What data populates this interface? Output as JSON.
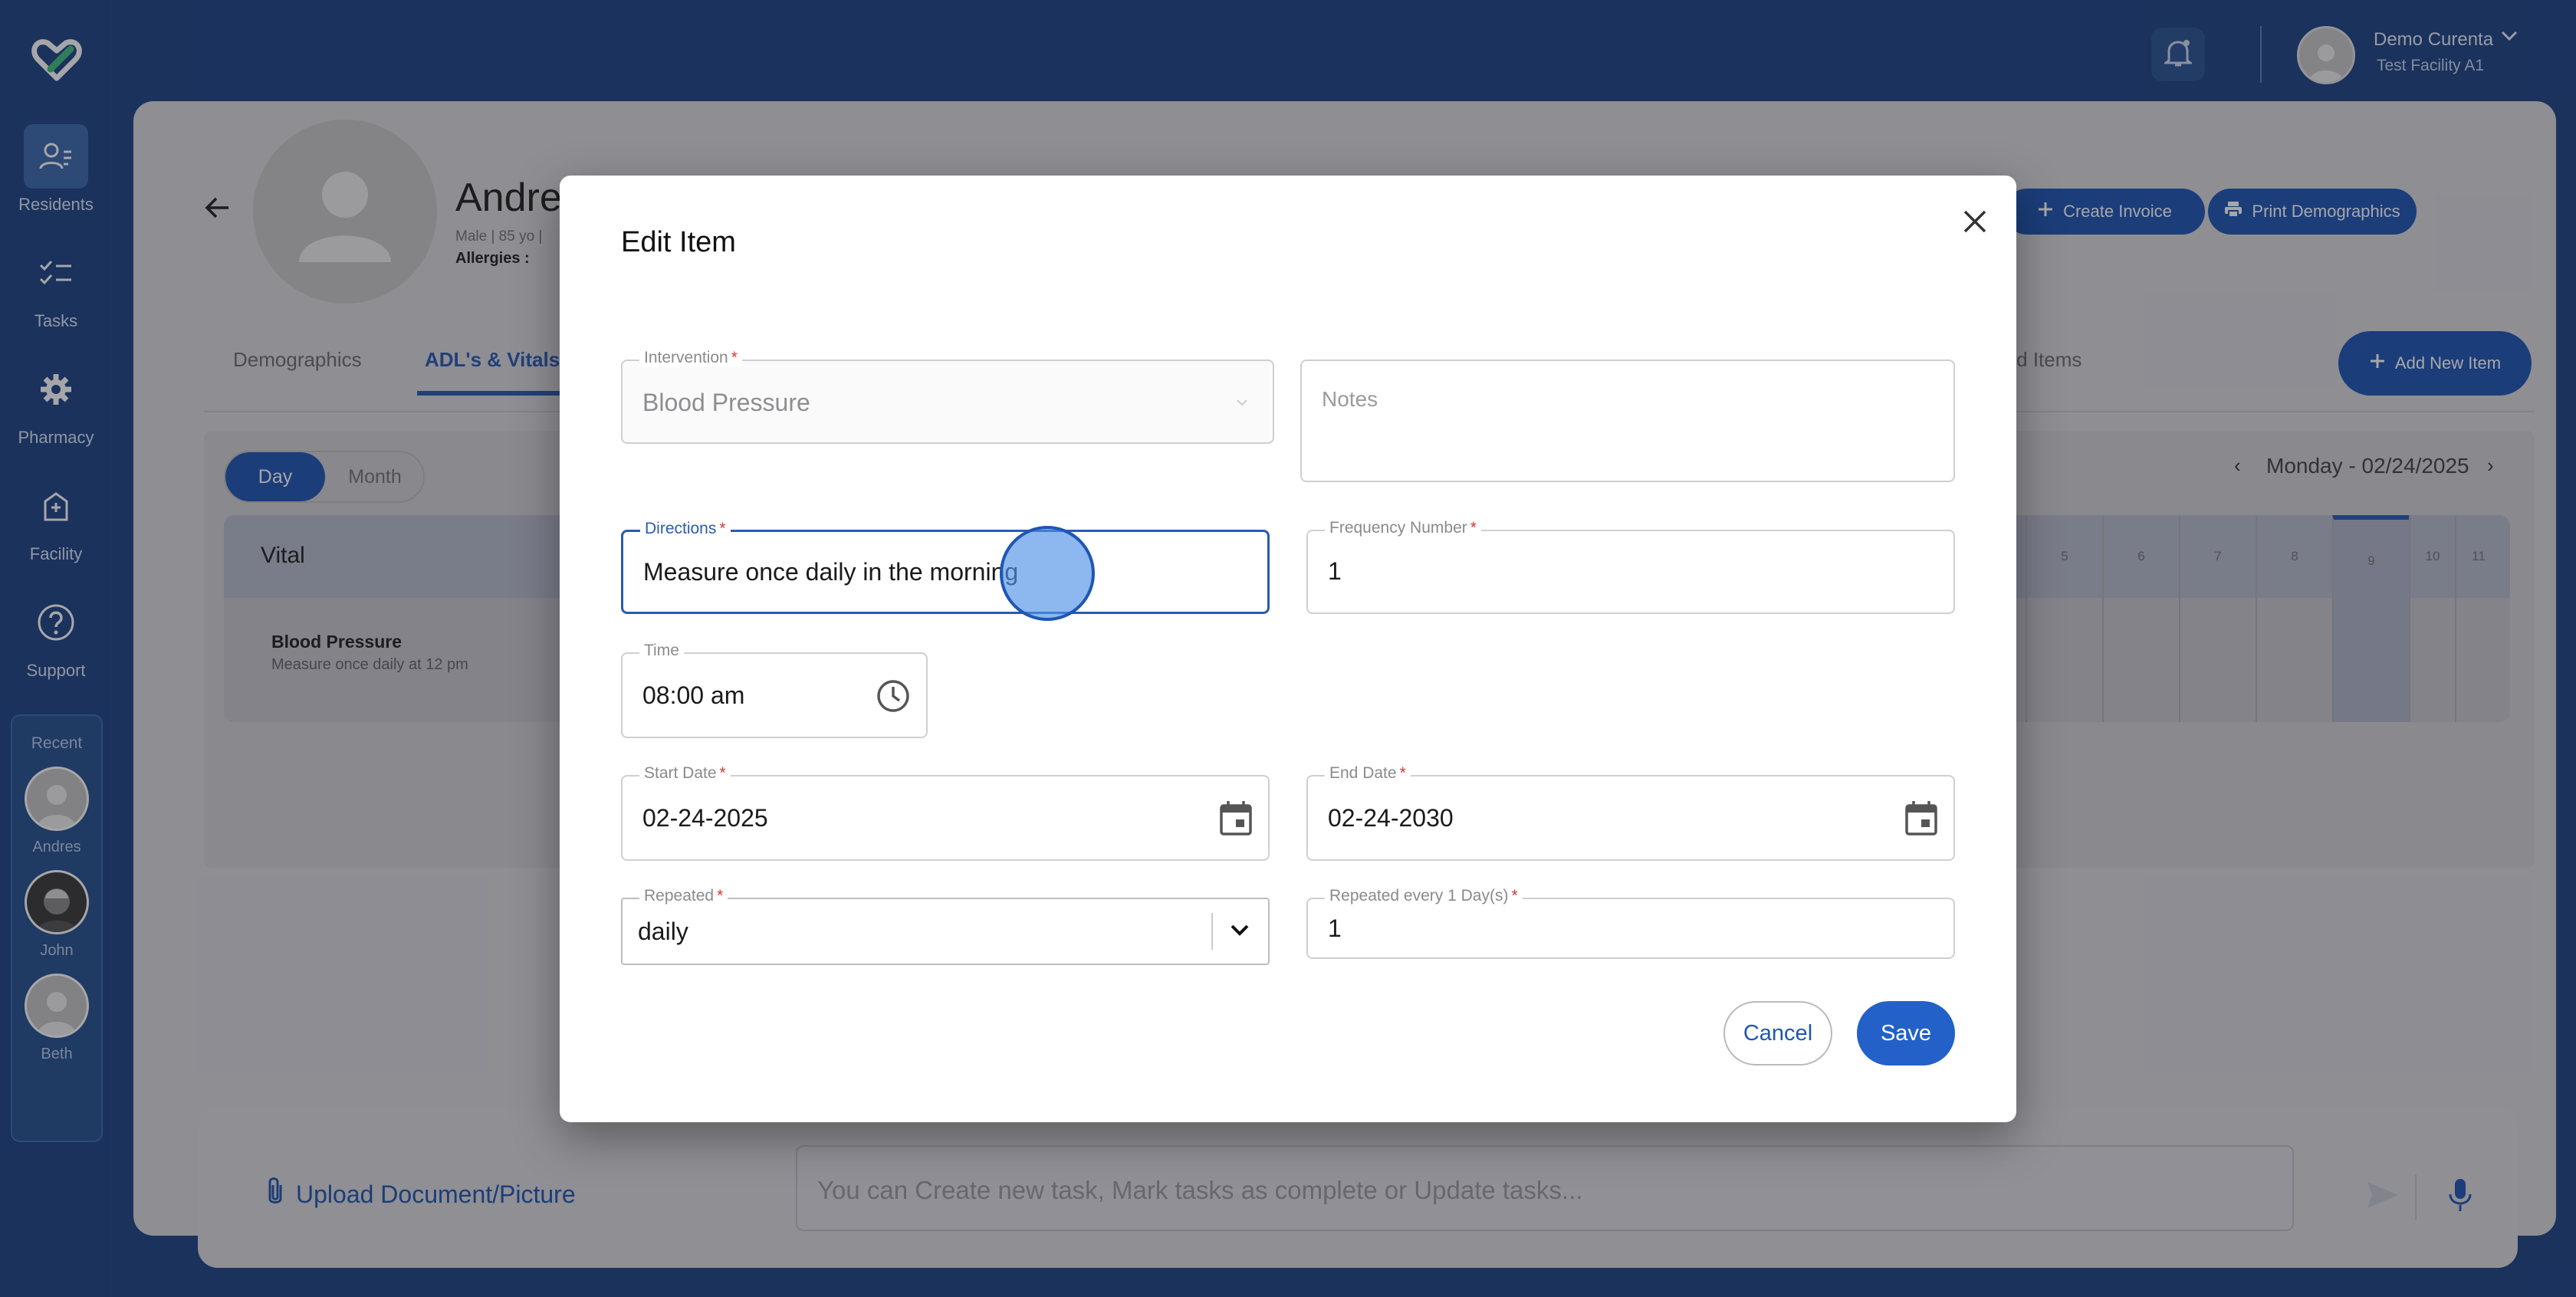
{
  "sidebar": {
    "items": [
      {
        "label": "Residents",
        "icon": "residents-icon"
      },
      {
        "label": "Tasks",
        "icon": "tasks-icon"
      },
      {
        "label": "Pharmacy",
        "icon": "gear-icon"
      },
      {
        "label": "Facility",
        "icon": "facility-icon"
      },
      {
        "label": "Support",
        "icon": "help-icon"
      }
    ],
    "recent": {
      "title": "Recent",
      "people": [
        {
          "name": "Andres"
        },
        {
          "name": "John"
        },
        {
          "name": "Beth"
        }
      ]
    }
  },
  "topbar": {
    "user_name": "Demo Curenta",
    "facility": "Test Facility A1"
  },
  "patient": {
    "name": "Andres",
    "meta": "Male | 85 yo |",
    "allergies_label": "Allergies :"
  },
  "header_actions": {
    "create_invoice": "Create Invoice",
    "print_demographics": "Print Demographics",
    "add_new_item": "Add New Item"
  },
  "tabs": {
    "demographics": "Demographics",
    "adls": "ADL's & Vitals",
    "partial_right": "eted Items"
  },
  "schedule": {
    "day": "Day",
    "month": "Month",
    "date": "Monday - 02/24/2025",
    "vital_title": "Vital",
    "row_name": "Blood Pressure",
    "row_desc": "Measure once daily at 12 pm",
    "hours": [
      "5",
      "6",
      "7",
      "8",
      "9",
      "10",
      "11"
    ]
  },
  "composer": {
    "upload_label": "Upload Document/Picture",
    "prompt_placeholder": "You can Create new task, Mark tasks as complete or Update tasks..."
  },
  "modal": {
    "title": "Edit Item",
    "required_mark": "*",
    "intervention": {
      "label": "Intervention",
      "value": "Blood Pressure"
    },
    "notes": {
      "placeholder": "Notes"
    },
    "directions": {
      "label": "Directions",
      "value": "Measure once daily in the morning"
    },
    "frequency": {
      "label": "Frequency Number",
      "value": "1"
    },
    "time": {
      "label": "Time",
      "value": "08:00 am"
    },
    "start_date": {
      "label": "Start Date",
      "value": "02-24-2025"
    },
    "end_date": {
      "label": "End Date",
      "value": "02-24-2030"
    },
    "repeated": {
      "label": "Repeated",
      "value": "daily"
    },
    "repeated_every": {
      "label": "Repeated every 1 Day(s)",
      "value": "1"
    },
    "cancel_label": "Cancel",
    "save_label": "Save"
  },
  "colors": {
    "primary": "#1f56b3",
    "sidebar": "#1d4483",
    "required": "#e03434"
  }
}
